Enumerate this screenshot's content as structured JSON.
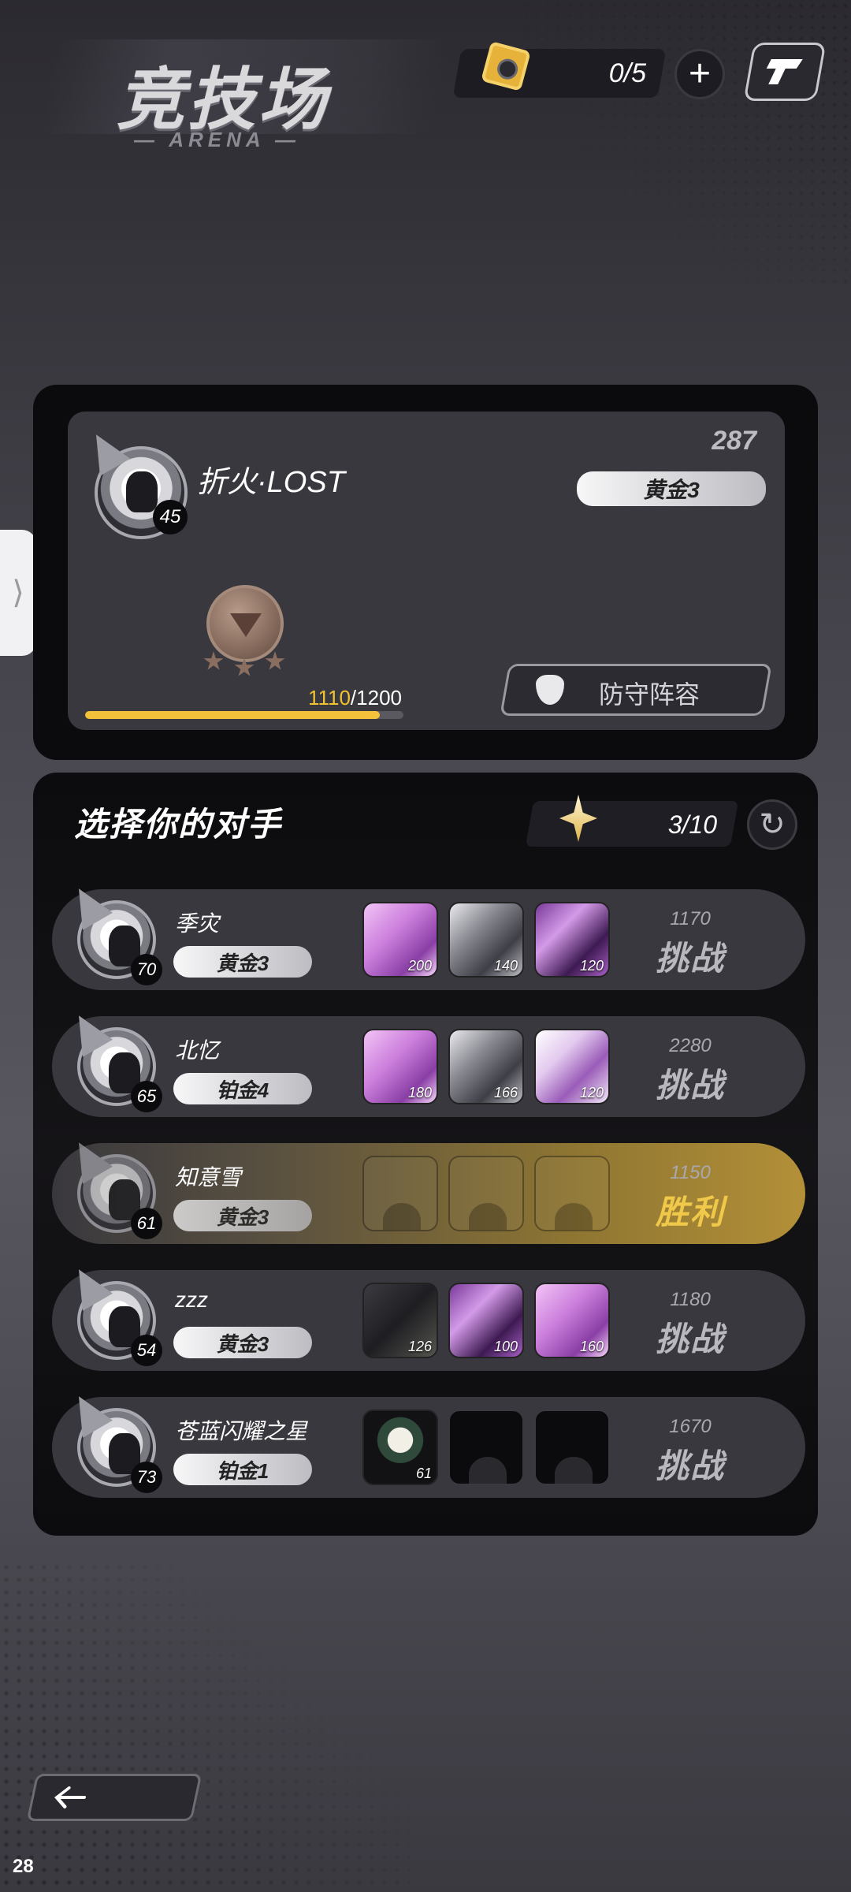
{
  "header": {
    "title": "竞技场",
    "subtitle": "— ARENA —",
    "tickets": "0/5"
  },
  "player": {
    "name": "折火·LOST",
    "level": "45",
    "score": "287",
    "rank": "黄金3",
    "xp_current": "1110",
    "xp_max": "1200",
    "xp_fraction": 0.925,
    "defense_label": "防守阵容"
  },
  "opponents_section": {
    "title": "选择你的对手",
    "challenges_left": "3/10"
  },
  "opponents": [
    {
      "name": "季灾",
      "level": "70",
      "rank": "黄金3",
      "score": "1170",
      "action": "挑战",
      "team": [
        {
          "style": "pink",
          "power": "200"
        },
        {
          "style": "gray",
          "power": "140"
        },
        {
          "style": "violet",
          "power": "120"
        }
      ]
    },
    {
      "name": "北忆",
      "level": "65",
      "rank": "铂金4",
      "score": "2280",
      "action": "挑战",
      "team": [
        {
          "style": "pink",
          "power": "180"
        },
        {
          "style": "gray",
          "power": "166"
        },
        {
          "style": "white",
          "power": "120"
        }
      ]
    },
    {
      "name": "知意雪",
      "level": "61",
      "rank": "黄金3",
      "score": "1150",
      "action": "胜利",
      "team": [
        {
          "style": "faded",
          "power": ""
        },
        {
          "style": "faded",
          "power": ""
        },
        {
          "style": "faded",
          "power": ""
        }
      ]
    },
    {
      "name": "zzz",
      "level": "54",
      "rank": "黄金3",
      "score": "1180",
      "action": "挑战",
      "team": [
        {
          "style": "dark",
          "power": "126"
        },
        {
          "style": "violet",
          "power": "100"
        },
        {
          "style": "pink",
          "power": "160"
        }
      ]
    },
    {
      "name": "苍蓝闪耀之星",
      "level": "73",
      "rank": "铂金1",
      "score": "1670",
      "action": "挑战",
      "team": [
        {
          "style": "char",
          "power": "61"
        },
        {
          "style": "empty",
          "power": ""
        },
        {
          "style": "empty",
          "power": ""
        }
      ]
    }
  ],
  "footer": {
    "fps": "28"
  },
  "colors": {
    "accent_gold": "#f4c23a",
    "win_gold": "#f0c94a",
    "card_bg": "#39383e"
  }
}
